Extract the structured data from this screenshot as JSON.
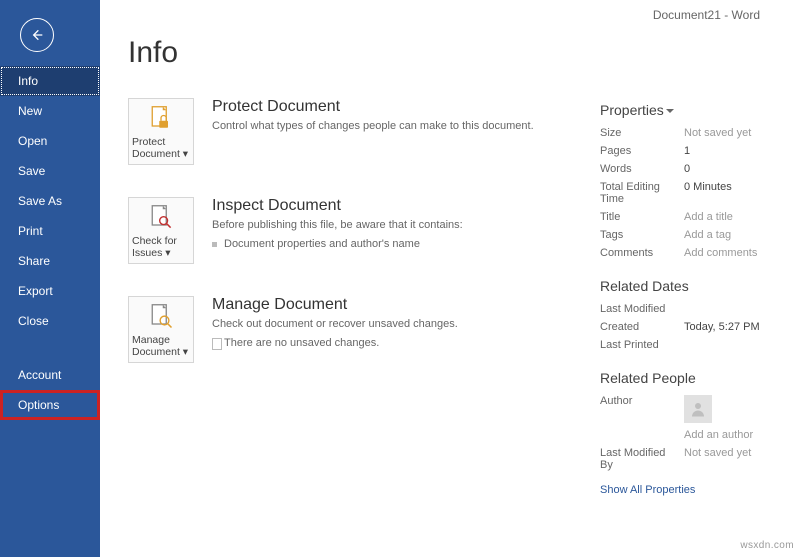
{
  "window": {
    "title": "Document21  -  Word"
  },
  "sidebar": {
    "items": [
      {
        "label": "Info"
      },
      {
        "label": "New"
      },
      {
        "label": "Open"
      },
      {
        "label": "Save"
      },
      {
        "label": "Save As"
      },
      {
        "label": "Print"
      },
      {
        "label": "Share"
      },
      {
        "label": "Export"
      },
      {
        "label": "Close"
      },
      {
        "label": "Account"
      },
      {
        "label": "Options"
      }
    ]
  },
  "page": {
    "heading": "Info"
  },
  "sections": {
    "protect": {
      "btn": "Protect Document ▾",
      "heading": "Protect Document",
      "desc": "Control what types of changes people can make to this document."
    },
    "inspect": {
      "btn": "Check for Issues ▾",
      "heading": "Inspect Document",
      "desc": "Before publishing this file, be aware that it contains:",
      "sub": "Document properties and author's name"
    },
    "manage": {
      "btn": "Manage Document ▾",
      "heading": "Manage Document",
      "desc": "Check out document or recover unsaved changes.",
      "sub": "There are no unsaved changes."
    }
  },
  "props": {
    "heading": "Properties",
    "rows": [
      {
        "label": "Size",
        "value": "Not saved yet",
        "placeholder": true
      },
      {
        "label": "Pages",
        "value": "1"
      },
      {
        "label": "Words",
        "value": "0"
      },
      {
        "label": "Total Editing Time",
        "value": "0 Minutes"
      },
      {
        "label": "Title",
        "value": "Add a title",
        "placeholder": true
      },
      {
        "label": "Tags",
        "value": "Add a tag",
        "placeholder": true
      },
      {
        "label": "Comments",
        "value": "Add comments",
        "placeholder": true
      }
    ],
    "dates": {
      "heading": "Related Dates",
      "rows": [
        {
          "label": "Last Modified",
          "value": ""
        },
        {
          "label": "Created",
          "value": "Today, 5:27 PM"
        },
        {
          "label": "Last Printed",
          "value": ""
        }
      ]
    },
    "people": {
      "heading": "Related People",
      "author_label": "Author",
      "add_author": "Add an author",
      "lastmod_label": "Last Modified By",
      "lastmod_value": "Not saved yet"
    },
    "show_all": "Show All Properties"
  },
  "watermark": "wsxdn.com"
}
